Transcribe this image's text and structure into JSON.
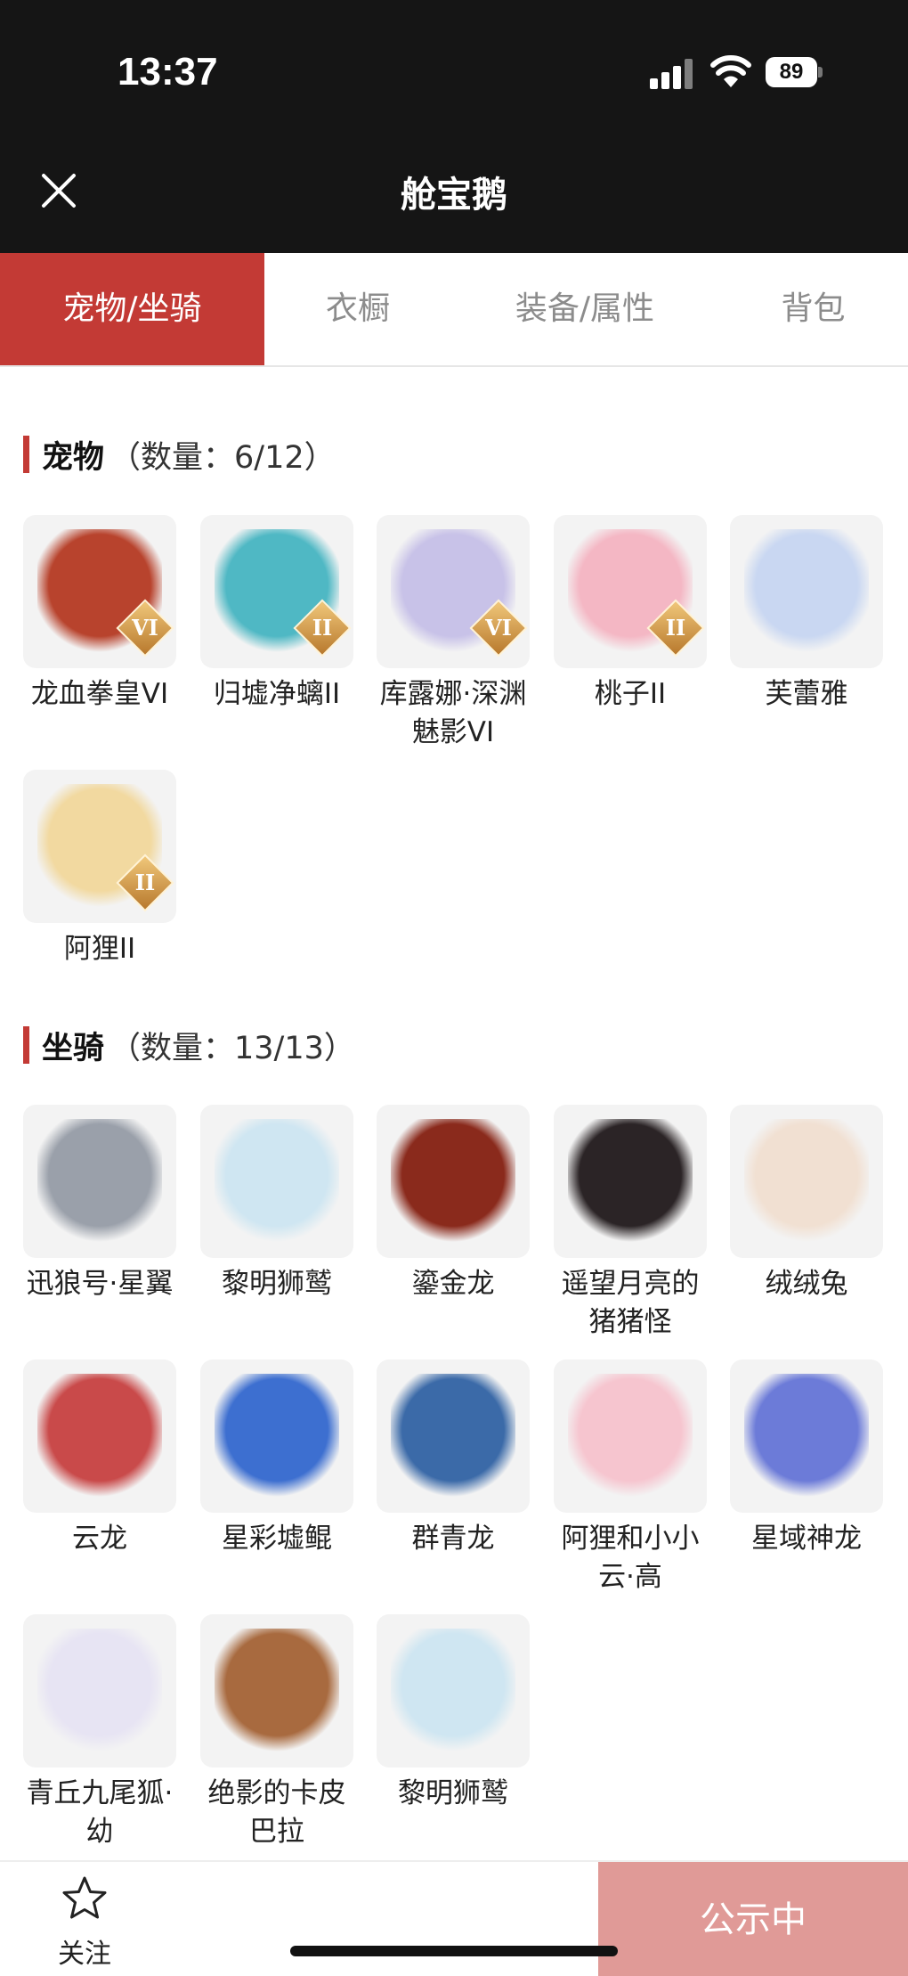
{
  "status_bar": {
    "time": "13:37",
    "battery": "89"
  },
  "header": {
    "title": "舱宝鹅"
  },
  "tabs": [
    {
      "label": "宠物/坐骑",
      "active": true
    },
    {
      "label": "衣橱",
      "active": false
    },
    {
      "label": "装备/属性",
      "active": false
    },
    {
      "label": "背包",
      "active": false
    }
  ],
  "pets_section": {
    "name": "宠物",
    "count": "（数量：6/12）"
  },
  "pets": [
    {
      "name": "龙血拳皇VI",
      "badge": "VI",
      "color": "#b8432d"
    },
    {
      "name": "归墟净螭II",
      "badge": "II",
      "color": "#4fb8c4"
    },
    {
      "name": "库露娜·深渊魅影VI",
      "badge": "VI",
      "color": "#c8c2e8"
    },
    {
      "name": "桃子II",
      "badge": "II",
      "color": "#f4b7c4"
    },
    {
      "name": "芙蕾雅",
      "badge": "",
      "color": "#c9d7f2"
    },
    {
      "name": "阿狸II",
      "badge": "II",
      "color": "#f2d9a0"
    }
  ],
  "mounts_section": {
    "name": "坐骑",
    "count": "（数量：13/13）"
  },
  "mounts": [
    {
      "name": "迅狼号·星翼",
      "color": "#9aa0aa"
    },
    {
      "name": "黎明狮鹫",
      "color": "#cfe6f2"
    },
    {
      "name": "鎏金龙",
      "color": "#8a2a1c"
    },
    {
      "name": "遥望月亮的猪猪怪",
      "color": "#2b2426"
    },
    {
      "name": "绒绒兔",
      "color": "#f1e0d2"
    },
    {
      "name": "云龙",
      "color": "#c94a4a"
    },
    {
      "name": "星彩墟鲲",
      "color": "#3d6fd0"
    },
    {
      "name": "群青龙",
      "color": "#3b6aa8"
    },
    {
      "name": "阿狸和小小云·高",
      "color": "#f6c5cf"
    },
    {
      "name": "星域神龙",
      "color": "#6c7bd8"
    },
    {
      "name": "青丘九尾狐·幼",
      "color": "#e7e4f3"
    },
    {
      "name": "绝影的卡皮巴拉",
      "color": "#a86a3f"
    },
    {
      "name": "黎明狮鹫",
      "color": "#cfe6f2"
    }
  ],
  "bottom_bar": {
    "follow_label": "关注",
    "status_button": "公示中"
  },
  "colors": {
    "accent": "#c33a35",
    "status_button": "#e09a97",
    "header_bg": "#151515"
  }
}
